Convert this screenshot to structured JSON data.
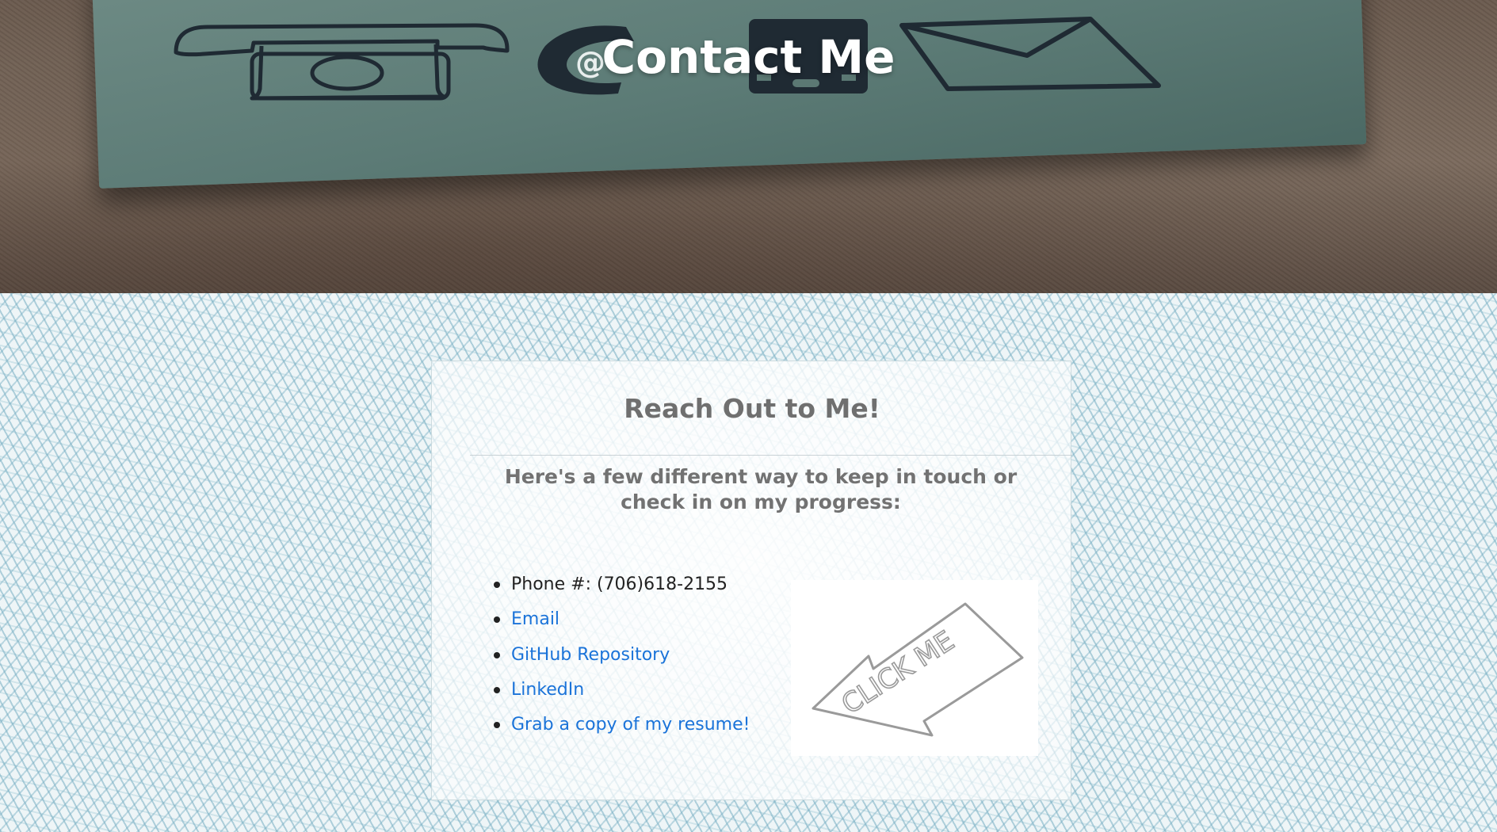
{
  "hero": {
    "title": "Contact Me",
    "icons": [
      "phone-icon",
      "at-sign-icon",
      "mobile-phone-icon",
      "envelope-icon"
    ]
  },
  "panel": {
    "heading": "Reach Out to Me!",
    "subheading": "Here's a few different way to keep in touch or check in on my progress:",
    "contacts": [
      {
        "label": "Phone #: (706)618-2155",
        "type": "text"
      },
      {
        "label": "Email",
        "type": "link"
      },
      {
        "label": "GitHub Repository",
        "type": "link"
      },
      {
        "label": "LinkedIn",
        "type": "link"
      },
      {
        "label": "Grab a copy of my resume!",
        "type": "link"
      }
    ],
    "click_image": {
      "text": "CLICK ME",
      "icon": "arrow-icon"
    }
  },
  "colors": {
    "link": "#1a73d9",
    "heading": "#6f6f6f",
    "hero_title": "#ffffff"
  }
}
